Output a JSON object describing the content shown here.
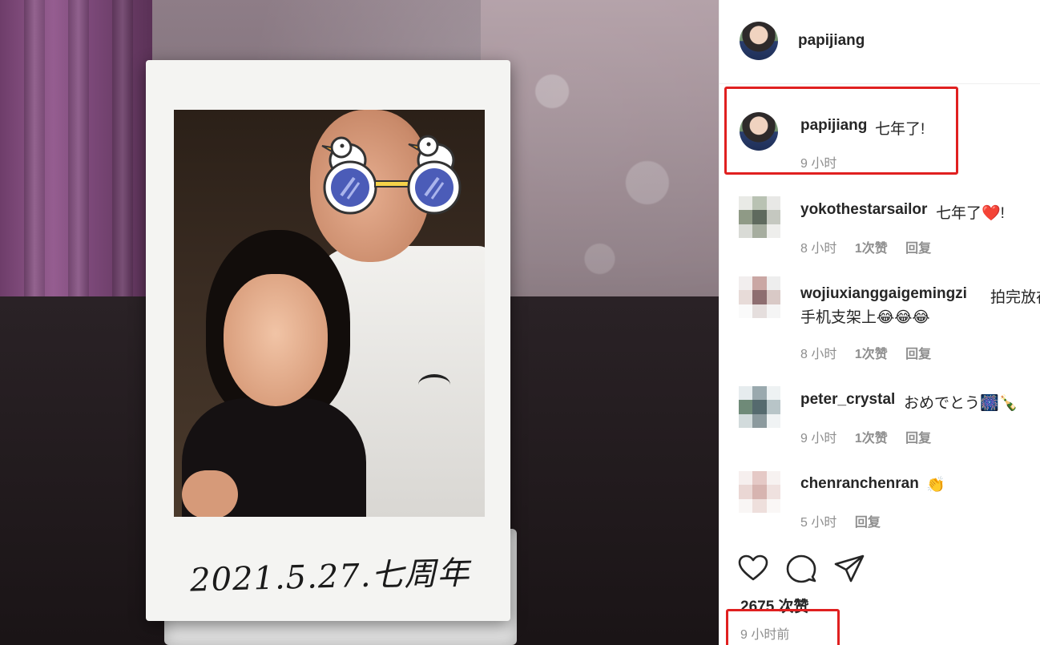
{
  "photo": {
    "caption_handwriting": "2021.5.27.七周年"
  },
  "post": {
    "author": "papijiang",
    "caption": "七年了!",
    "caption_time": "9 小时",
    "likes": "2675 次赞",
    "posted_ago": "9 小时前"
  },
  "comments": [
    {
      "user": "yokothestarsailor",
      "text": "七年了❤️!",
      "time": "8 小时",
      "likes": "1次赞",
      "reply": "回复"
    },
    {
      "user": "wojiuxianggaigemingzi",
      "text": "拍完放在",
      "text2": "手机支架上😂😂😂",
      "time": "8 小时",
      "likes": "1次赞",
      "reply": "回复"
    },
    {
      "user": "peter_crystal",
      "text": "おめでとう🎆🍾",
      "time": "9 小时",
      "likes": "1次赞",
      "reply": "回复"
    },
    {
      "user": "chenranchenran",
      "text": "👏",
      "time": "5 小时",
      "reply": "回复"
    }
  ],
  "icons": [
    "heart-icon",
    "comment-icon",
    "share-icon"
  ],
  "colors": {
    "highlight": "#e02020",
    "text": "#262626",
    "muted": "#8e8e8e"
  }
}
